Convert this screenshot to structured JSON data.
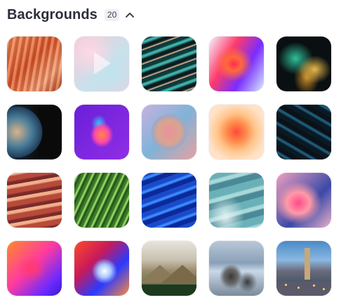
{
  "section": {
    "title": "Backgrounds",
    "count": "20",
    "collapse_icon": "chevron-up-icon"
  },
  "backgrounds": [
    {
      "name": "orange-canyon-waves"
    },
    {
      "name": "pastel-play"
    },
    {
      "name": "teal-silk-waves"
    },
    {
      "name": "red-purple-gradient"
    },
    {
      "name": "dark-gold-abstract"
    },
    {
      "name": "planet-jupiter"
    },
    {
      "name": "purple-fish-app-icon"
    },
    {
      "name": "gradient-sphere"
    },
    {
      "name": "orange-glow-orb"
    },
    {
      "name": "dark-blue-swirls"
    },
    {
      "name": "red-rock-canyon"
    },
    {
      "name": "green-palm-leaf"
    },
    {
      "name": "blue-wavy-lines"
    },
    {
      "name": "teal-sand-dunes"
    },
    {
      "name": "pink-blur-gradient"
    },
    {
      "name": "orange-purple-gradient"
    },
    {
      "name": "red-blue-swirl"
    },
    {
      "name": "misty-mountain-forest"
    },
    {
      "name": "rocky-shore"
    },
    {
      "name": "city-plaza-dusk"
    }
  ]
}
